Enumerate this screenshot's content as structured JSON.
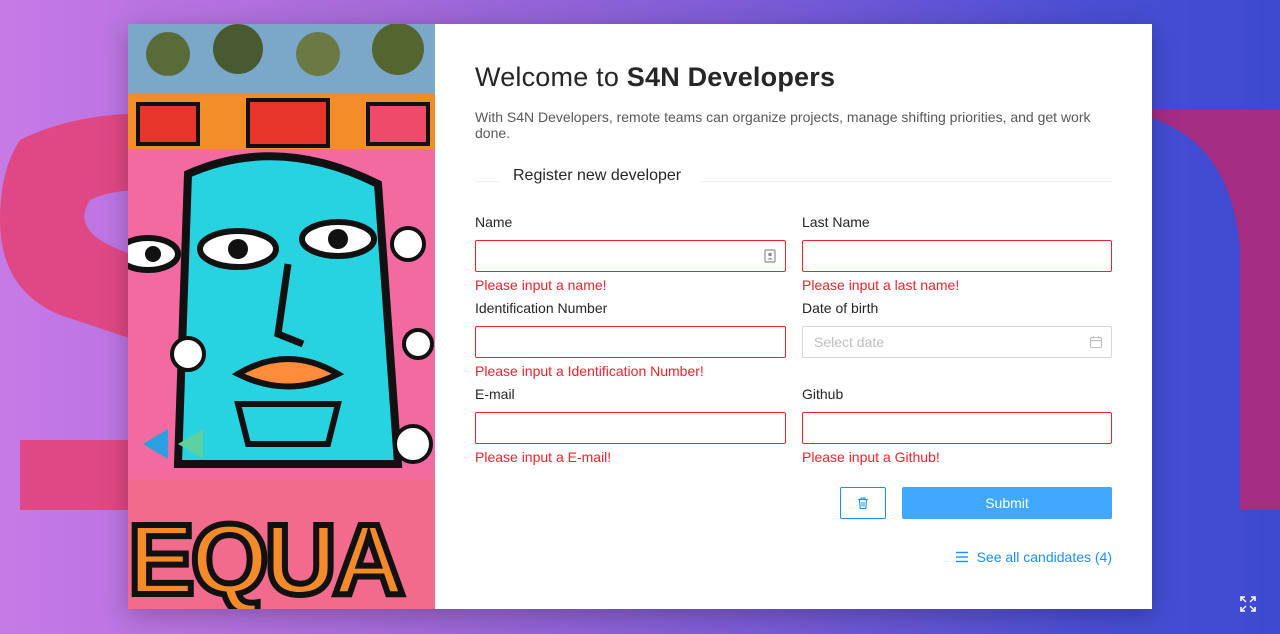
{
  "header": {
    "title_prefix": "Welcome to ",
    "title_brand": "S4N Developers",
    "description": "With S4N Developers, remote teams can organize projects, manage shifting priorities, and get work done."
  },
  "form": {
    "section_title": "Register new developer",
    "fields": [
      {
        "label": "Name",
        "value": "",
        "error": "Please input a name!",
        "icon": "contact-card-icon"
      },
      {
        "label": "Last Name",
        "value": "",
        "error": "Please input a last name!"
      },
      {
        "label": "Identification Number",
        "value": "",
        "error": "Please input a Identification Number!"
      },
      {
        "label": "Date of birth",
        "placeholder": "Select date",
        "icon": "calendar-icon"
      },
      {
        "label": "E-mail",
        "value": "",
        "error": "Please input a E-mail!"
      },
      {
        "label": "Github",
        "value": "",
        "error": "Please input a Github!"
      }
    ],
    "submit_label": "Submit",
    "delete_icon": "trash-icon"
  },
  "footer": {
    "see_all_label": "See all candidates (4)",
    "list_icon": "list-icon"
  },
  "colors": {
    "primary": "#1890ff",
    "submit": "#40a9ff",
    "error": "#f5222d"
  }
}
